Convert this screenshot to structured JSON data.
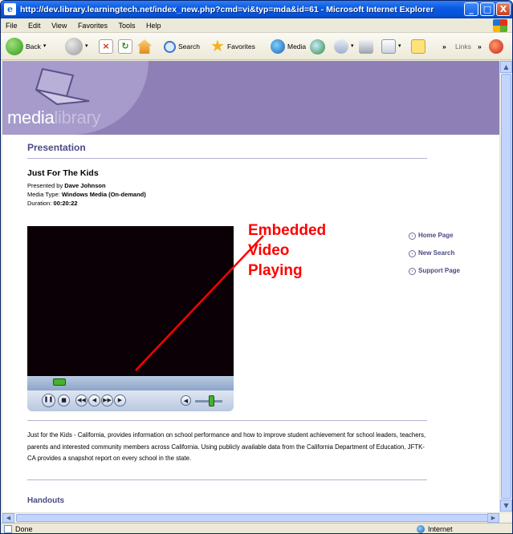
{
  "window": {
    "title": "http://dev.library.learningtech.net/index_new.php?cmd=vi&typ=mda&id=61 - Microsoft Internet Explorer",
    "buttons": {
      "minimize": "_",
      "maximize": "□",
      "close": "X"
    }
  },
  "menubar": {
    "items": [
      {
        "label": "File"
      },
      {
        "label": "Edit"
      },
      {
        "label": "View"
      },
      {
        "label": "Favorites"
      },
      {
        "label": "Tools"
      },
      {
        "label": "Help"
      }
    ]
  },
  "toolbar": {
    "back_label": "Back",
    "search_label": "Search",
    "favorites_label": "Favorites",
    "media_label": "Media",
    "links_label": "Links",
    "chevron": "»"
  },
  "page": {
    "logo": {
      "part1": "media",
      "part2": "library"
    },
    "section_title": "Presentation",
    "presentation_title": "Just For The Kids",
    "meta": {
      "presenter_label": "Presented by",
      "presenter": "Dave Johnson",
      "media_type_label": "Media Type:",
      "media_type": "Windows Media (On-demand)",
      "duration_label": "Duration:",
      "duration": "00:20:22"
    },
    "annotation": [
      "Embedded",
      "Video",
      "Playing"
    ],
    "side_links": [
      {
        "label": "Home Page"
      },
      {
        "label": "New Search"
      },
      {
        "label": "Support Page"
      }
    ],
    "description": "Just for the Kids - California, provides information on school performance and how to improve student achievement for school leaders, teachers, parents and interested community members across California. Using publicly available data from the California Department of Education, JFTK-CA provides a snapshot report on every school in the state.",
    "handouts_title": "Handouts"
  },
  "player": {
    "seek_position": 0.12,
    "volume": 0.6
  },
  "statusbar": {
    "status": "Done",
    "zone": "Internet"
  },
  "colors": {
    "banner": "#8e80b6",
    "heading": "#4c4a85",
    "annotation": "#ff0000",
    "video_bg": "#0b0006"
  }
}
